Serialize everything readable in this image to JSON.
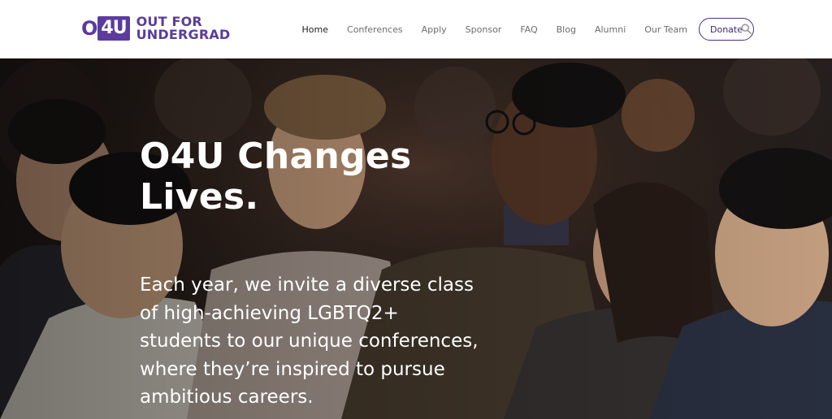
{
  "logo": {
    "mark_o": "O",
    "mark_4u": "4U",
    "line1": "OUT FOR",
    "line2": "UNDERGRAD",
    "brand_color": "#5b3c9c"
  },
  "nav": {
    "items": [
      {
        "label": "Home",
        "active": true
      },
      {
        "label": "Conferences",
        "active": false
      },
      {
        "label": "Apply",
        "active": false
      },
      {
        "label": "Sponsor",
        "active": false
      },
      {
        "label": "FAQ",
        "active": false
      },
      {
        "label": "Blog",
        "active": false
      },
      {
        "label": "Alumni",
        "active": false
      },
      {
        "label": "Our Team",
        "active": false
      }
    ],
    "donate_label": "Donate",
    "search_icon": "search-icon"
  },
  "hero": {
    "headline": "O4U Changes\nLives.",
    "body": "Each year, we invite a diverse class\nof high-achieving LGBTQ2+\nstudents to our unique conferences,\nwhere they’re inspired to pursue\nambitious careers.",
    "image": "conference-audience-photo"
  }
}
